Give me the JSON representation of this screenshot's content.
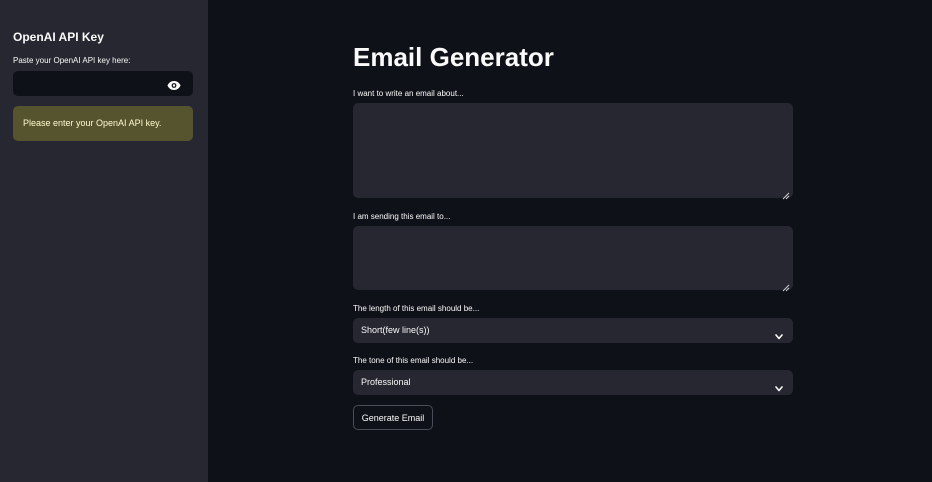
{
  "sidebar": {
    "header": "OpenAI API Key",
    "api_key_label": "Paste your OpenAI API key here:",
    "api_key_value": "",
    "visibility_icon": "eye-icon",
    "warning": "Please enter your OpenAI API key.",
    "warning_color": "#56532f"
  },
  "main": {
    "title": "Email Generator",
    "topic_label": "I want to write an email about...",
    "topic_value": "",
    "recipient_label": "I am sending this email to...",
    "recipient_value": "",
    "length_label": "The length of this email should be...",
    "length_value": "Short(few line(s))",
    "tone_label": "The tone of this email should be...",
    "tone_value": "Professional",
    "generate_button": "Generate Email"
  },
  "colors": {
    "background": "#0e1117",
    "sidebar_background": "#262730",
    "input_background": "#262730"
  }
}
